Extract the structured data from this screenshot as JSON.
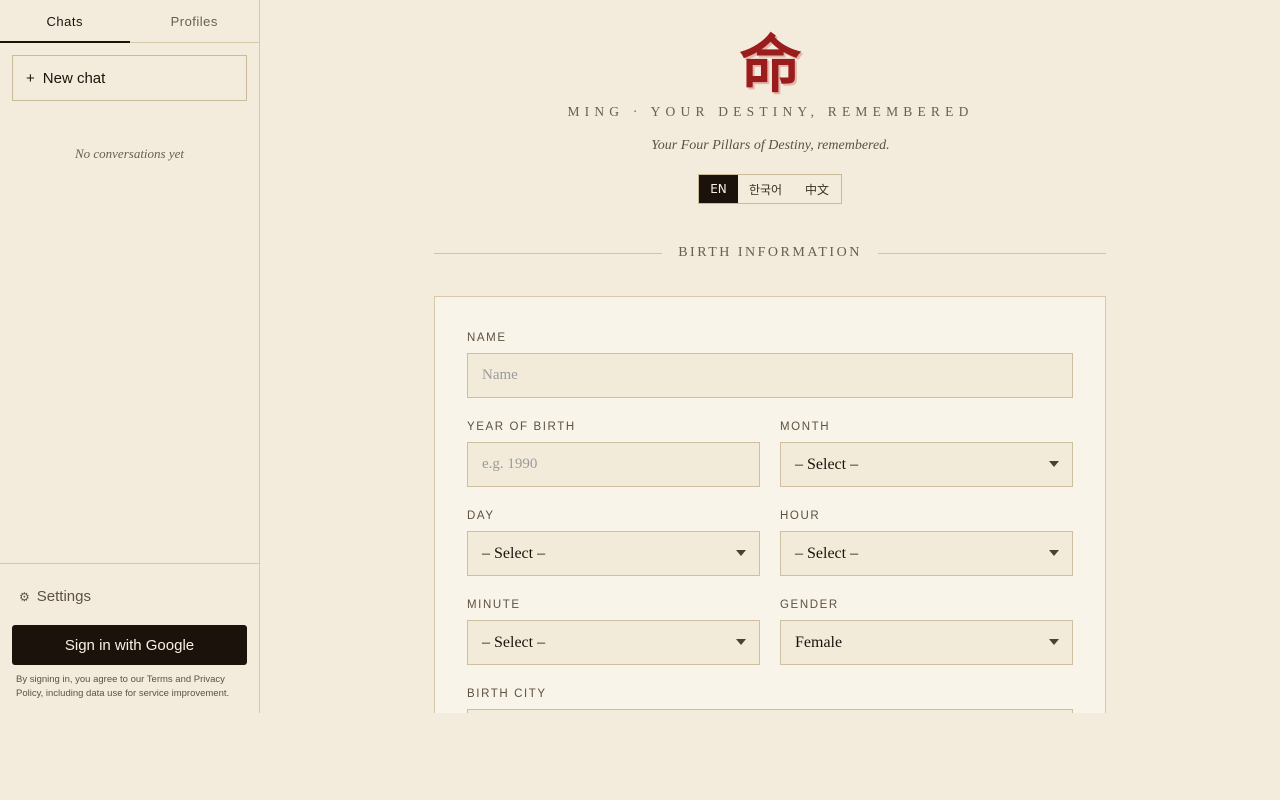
{
  "sidebar": {
    "tabs": [
      {
        "label": "Chats",
        "active": true
      },
      {
        "label": "Profiles",
        "active": false
      }
    ],
    "new_chat_label": "New chat",
    "empty_note": "No conversations yet",
    "settings_label": "Settings",
    "sign_in_label": "Sign in with Google",
    "legal_text": "By signing in, you agree to our Terms and Privacy Policy, including data use for service improvement."
  },
  "header": {
    "logo_char": "命",
    "brand": "MING · YOUR DESTINY, REMEMBERED",
    "tagline": "Your Four Pillars of Destiny, remembered.",
    "languages": [
      "EN",
      "한국어",
      "中文"
    ],
    "active_language": "EN"
  },
  "form": {
    "section_title": "BIRTH INFORMATION",
    "name": {
      "label": "NAME",
      "placeholder": "Name",
      "value": ""
    },
    "year": {
      "label": "YEAR OF BIRTH",
      "placeholder": "e.g. 1990",
      "value": ""
    },
    "month": {
      "label": "MONTH",
      "value": "– Select –"
    },
    "day": {
      "label": "DAY",
      "value": "– Select –"
    },
    "hour": {
      "label": "HOUR",
      "value": "– Select –"
    },
    "minute": {
      "label": "MINUTE",
      "value": "– Select –"
    },
    "gender": {
      "label": "GENDER",
      "value": "Female"
    },
    "birth_city": {
      "label": "BIRTH CITY"
    }
  },
  "colors": {
    "background": "#f3ecdd",
    "ink": "#1a120b",
    "accent_red": "#9b1c1c",
    "card": "#f8f4ea",
    "field": "#f3ebd9"
  }
}
